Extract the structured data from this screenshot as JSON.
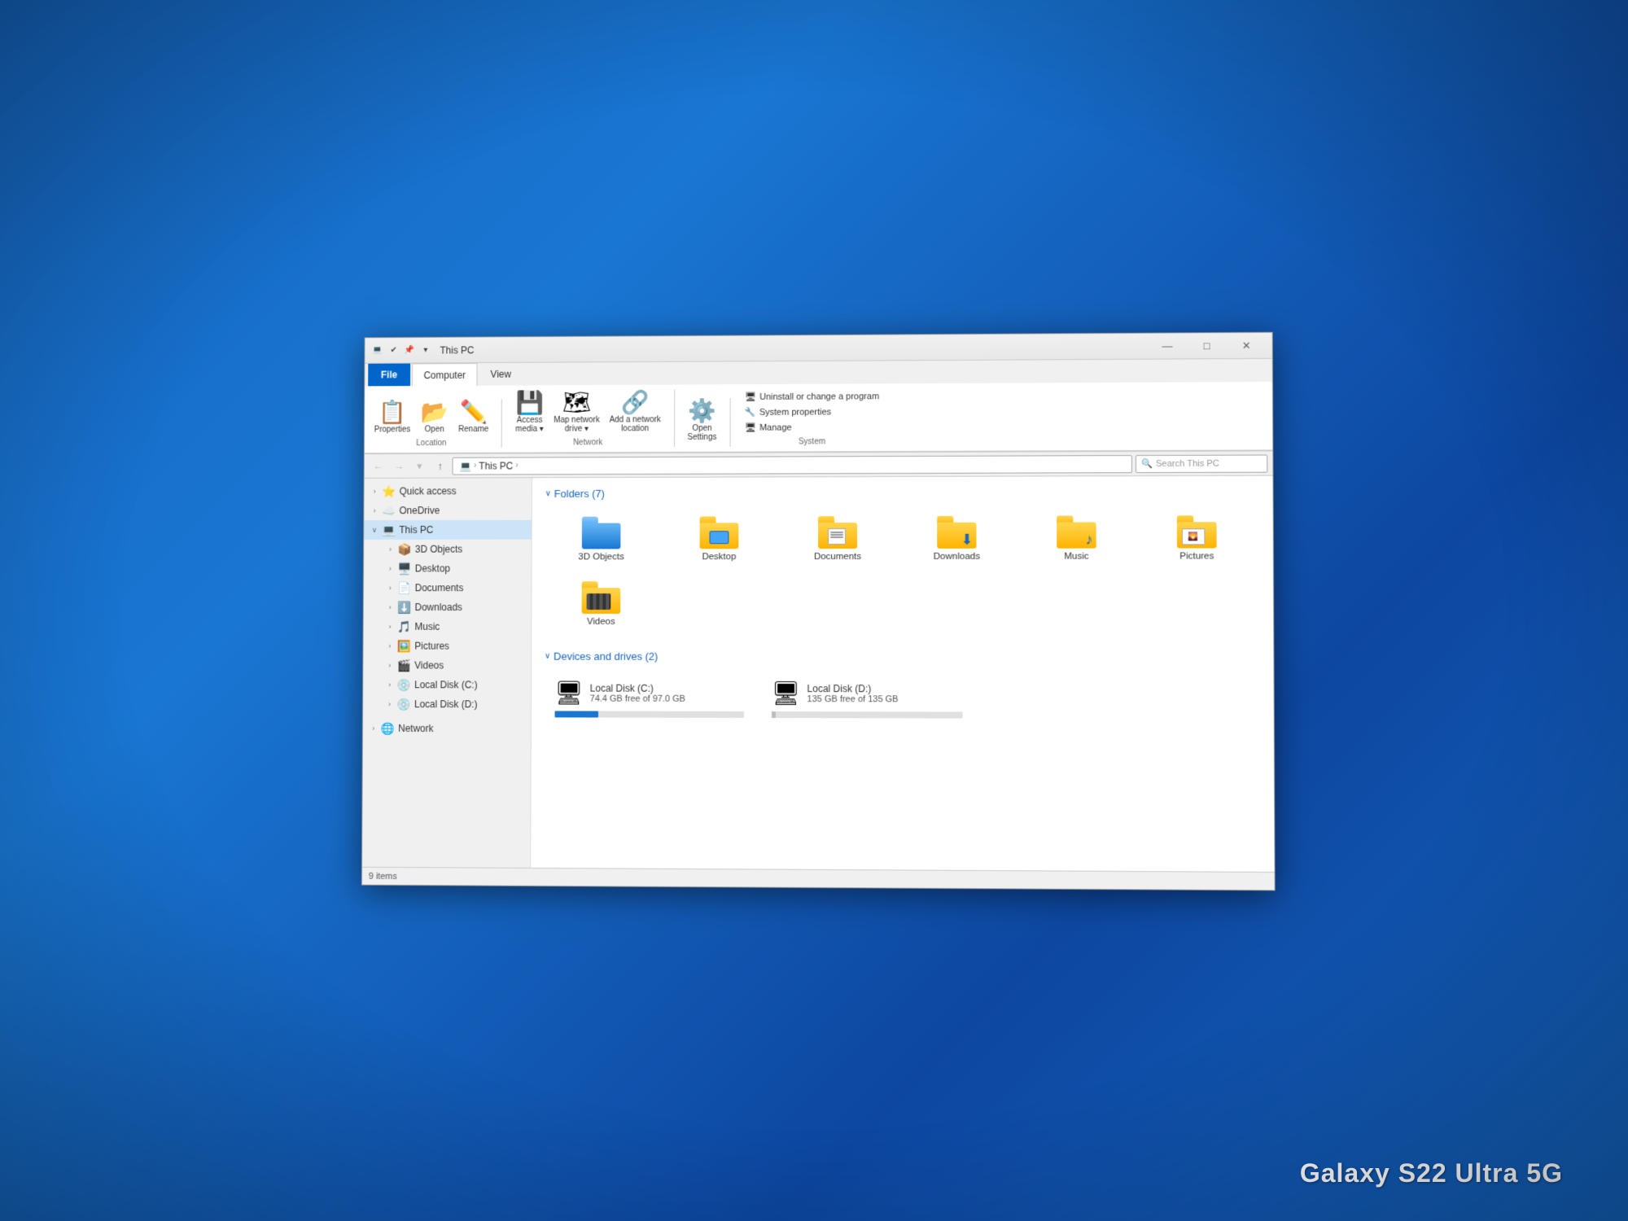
{
  "watermark": "Galaxy S22 Ultra 5G",
  "window": {
    "title": "This PC",
    "title_bar": {
      "icon": "💻",
      "tabs": [
        "File",
        "Computer",
        "View"
      ],
      "active_tab": "Computer",
      "controls": {
        "minimize": "—",
        "maximize": "□",
        "close": "✕"
      }
    },
    "ribbon": {
      "groups": [
        {
          "label": "Location",
          "items": [
            {
              "icon": "📋",
              "label": "Properties"
            },
            {
              "icon": "📂",
              "label": "Open"
            },
            {
              "icon": "✏️",
              "label": "Rename"
            }
          ]
        },
        {
          "label": "Network",
          "items": [
            {
              "icon": "💾",
              "label": "Access media"
            },
            {
              "icon": "🗺",
              "label": "Map network drive"
            },
            {
              "icon": "🔗",
              "label": "Add a network location"
            }
          ]
        },
        {
          "label": "",
          "items": [
            {
              "icon": "⚙️",
              "label": "Open Settings"
            }
          ]
        },
        {
          "label": "System",
          "items": [
            {
              "label": "Uninstall or change a program"
            },
            {
              "label": "System properties"
            },
            {
              "label": "Manage"
            }
          ]
        }
      ]
    },
    "address_bar": {
      "path": "This PC",
      "breadcrumbs": [
        "This PC"
      ],
      "search_placeholder": "Search This PC"
    },
    "sidebar": {
      "items": [
        {
          "label": "Quick access",
          "icon": "⭐",
          "level": 0,
          "expanded": false
        },
        {
          "label": "OneDrive",
          "icon": "☁️",
          "level": 0,
          "expanded": false
        },
        {
          "label": "This PC",
          "icon": "💻",
          "level": 0,
          "expanded": true,
          "selected": true
        },
        {
          "label": "3D Objects",
          "icon": "📦",
          "level": 1
        },
        {
          "label": "Desktop",
          "icon": "🖥️",
          "level": 1
        },
        {
          "label": "Documents",
          "icon": "📄",
          "level": 1
        },
        {
          "label": "Downloads",
          "icon": "⬇️",
          "level": 1
        },
        {
          "label": "Music",
          "icon": "🎵",
          "level": 1
        },
        {
          "label": "Pictures",
          "icon": "🖼️",
          "level": 1
        },
        {
          "label": "Videos",
          "icon": "🎬",
          "level": 1
        },
        {
          "label": "Local Disk (C:)",
          "icon": "💿",
          "level": 1
        },
        {
          "label": "Local Disk (D:)",
          "icon": "💿",
          "level": 1
        },
        {
          "label": "Network",
          "icon": "🌐",
          "level": 0,
          "expanded": false
        }
      ]
    },
    "content": {
      "folders_section": {
        "label": "Folders (7)",
        "items": [
          {
            "name": "3D Objects",
            "type": "folder-3d"
          },
          {
            "name": "Desktop",
            "type": "folder-desktop"
          },
          {
            "name": "Documents",
            "type": "folder-docs"
          },
          {
            "name": "Downloads",
            "type": "folder-downloads"
          },
          {
            "name": "Music",
            "type": "folder-music"
          },
          {
            "name": "Pictures",
            "type": "folder-pictures"
          },
          {
            "name": "Videos",
            "type": "folder-videos"
          }
        ]
      },
      "drives_section": {
        "label": "Devices and drives (2)",
        "drives": [
          {
            "name": "Local Disk (C:)",
            "icon": "💽",
            "free": "74.4 GB free of 97.0 GB",
            "fill_percent": 23,
            "fill_class": "c-drive"
          },
          {
            "name": "Local Disk (D:)",
            "icon": "💽",
            "free": "135 GB free of 135 GB",
            "fill_percent": 2,
            "fill_class": "d-drive"
          }
        ]
      }
    },
    "status_bar": {
      "text": "9 items"
    }
  }
}
